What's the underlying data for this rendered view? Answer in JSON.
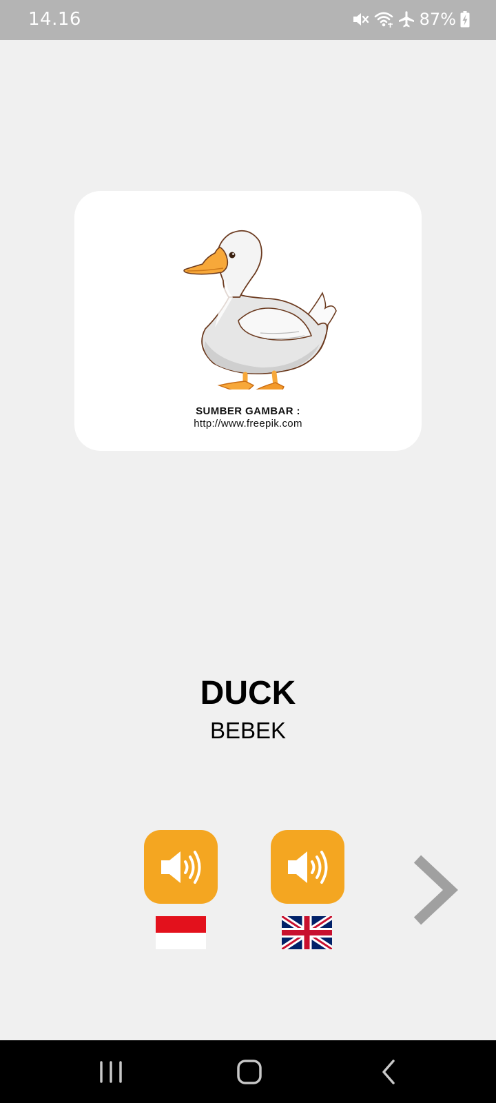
{
  "status_bar": {
    "time": "14.16",
    "battery": "87%",
    "icons": [
      "mute-icon",
      "wifi-icon",
      "airplane-mode-icon",
      "battery-charging-icon"
    ]
  },
  "card": {
    "image": "duck-illustration",
    "credit_title": "SUMBER GAMBAR :",
    "credit_url": "http://www.freepik.com"
  },
  "word": {
    "english": "DUCK",
    "indonesian": "BEBEK"
  },
  "controls": {
    "sound_indonesian": {
      "icon": "speaker-icon",
      "flag": "indonesia-flag"
    },
    "sound_english": {
      "icon": "speaker-icon",
      "flag": "uk-flag"
    },
    "next": {
      "icon": "chevron-right-icon"
    }
  },
  "colors": {
    "background": "#f0f0f0",
    "status_bar": "#b4b4b4",
    "accent": "#f4a621",
    "chevron": "#a0a0a0",
    "nav_bar": "#000000"
  },
  "nav_bar": [
    "recents-button",
    "home-button",
    "back-button"
  ]
}
